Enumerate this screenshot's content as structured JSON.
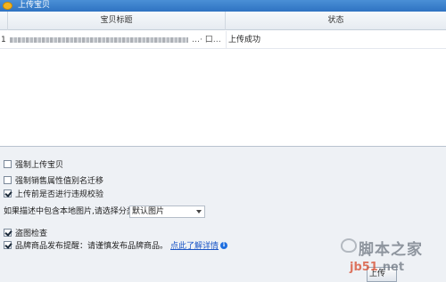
{
  "window": {
    "title": "上传宝贝"
  },
  "table": {
    "headers": [
      "",
      "宝贝标题",
      "状态"
    ],
    "rows": [
      {
        "index": "1",
        "title_tail": "…· 口…",
        "status": "上传成功"
      }
    ]
  },
  "options": {
    "force_upload": {
      "label": "强制上传宝贝",
      "checked": false
    },
    "force_sales_attr": {
      "label": "强制销售属性值别名迁移",
      "checked": false
    },
    "violation_check": {
      "label": "上传前是否进行违规校验",
      "checked": true
    },
    "local_image_label": "如果描述中包含本地图片,请选择分类",
    "local_image_select": {
      "value": "默认图片"
    },
    "image_theft_check": {
      "label": "盗图检查",
      "checked": true
    },
    "brand_reminder": {
      "label": "品牌商品发布提醒：请谨慎发布品牌商品。",
      "checked": true,
      "link": "点此了解详情"
    }
  },
  "footer": {
    "upload_button_label": "上传"
  },
  "watermark": {
    "line1": "脚本之家",
    "line2_a": "jb51",
    "line2_b": ".net"
  }
}
